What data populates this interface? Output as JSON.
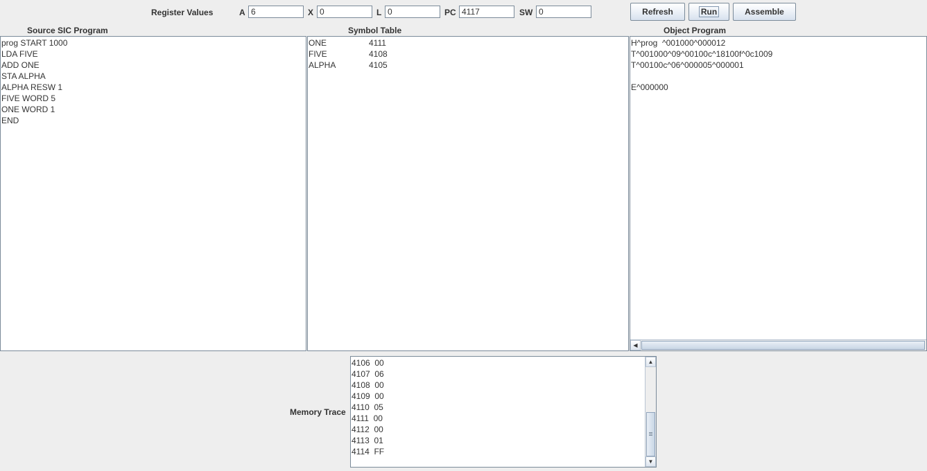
{
  "registers": {
    "title": "Register Values",
    "A": {
      "label": "A",
      "value": "6"
    },
    "X": {
      "label": "X",
      "value": "0"
    },
    "L": {
      "label": "L",
      "value": "0"
    },
    "PC": {
      "label": "PC",
      "value": "4117"
    },
    "SW": {
      "label": "SW",
      "value": "0"
    }
  },
  "buttons": {
    "refresh": "Refresh",
    "run": "Run",
    "assemble": "Assemble"
  },
  "source": {
    "title": "Source SIC Program",
    "lines": [
      "prog START 1000",
      "LDA FIVE",
      "ADD ONE",
      "STA ALPHA",
      "ALPHA RESW 1",
      "FIVE WORD 5",
      "ONE WORD 1",
      "END"
    ]
  },
  "symbols": {
    "title": "Symbol Table",
    "rows": [
      {
        "name": "ONE",
        "addr": "4111"
      },
      {
        "name": "FIVE",
        "addr": "4108"
      },
      {
        "name": "ALPHA",
        "addr": "4105"
      }
    ]
  },
  "object": {
    "title": "Object Program",
    "lines": [
      "H^prog  ^001000^000012",
      "T^001000^09^00100c^18100f^0c1009",
      "T^00100c^06^000005^000001",
      "",
      "E^000000"
    ]
  },
  "memory": {
    "title": "Memory Trace",
    "lines": [
      "4106  00",
      "4107  06",
      "4108  00",
      "4109  00",
      "4110  05",
      "4111  00",
      "4112  00",
      "4113  01",
      "4114  FF"
    ]
  },
  "icons": {
    "scroll_up": "▲",
    "scroll_down": "▼",
    "scroll_left": "◀",
    "scroll_right": "▶"
  }
}
